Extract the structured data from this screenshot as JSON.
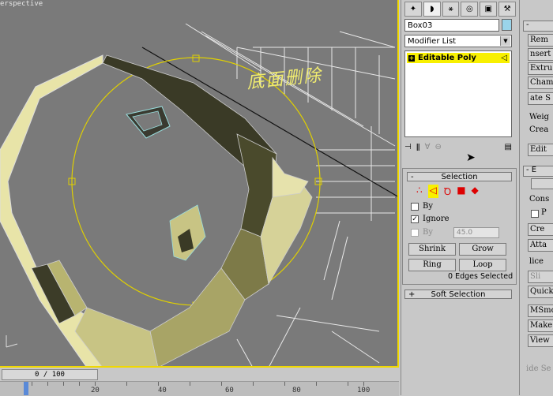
{
  "viewport": {
    "label": "erspective",
    "annotation": "底面删除"
  },
  "timeline": {
    "frame": "0 / 100",
    "ruler_ticks": [
      "20",
      "40",
      "60",
      "80",
      "100"
    ]
  },
  "panel": {
    "tabs": [
      "create-icon",
      "modify-icon",
      "hierarchy-icon",
      "motion-icon",
      "display-icon",
      "utilities-icon"
    ],
    "object_name": "Box03",
    "object_color": "#9ad4ea",
    "modifier_list": "Modifier List",
    "stack_item": "Editable Poly",
    "selection": {
      "title": "Selection",
      "by_vertex": "By",
      "ignore_backfacing": "Ignore",
      "by_angle": "By",
      "angle_value": "45.0",
      "shrink": "Shrink",
      "grow": "Grow",
      "ring": "Ring",
      "loop": "Loop",
      "status": "0 Edges Selected"
    },
    "soft_selection": "Soft Selection"
  },
  "panel2": {
    "buttons_top": [
      "Rem",
      "nsert",
      "Extru",
      "Chamf",
      "ate S"
    ],
    "weld_label": "Weig",
    "crease_label": "Crea",
    "edit_label": "Edit",
    "section_b": "E",
    "cons_label": "Cons",
    "p_label": "P",
    "create_btn": "Cre",
    "attach_btn": "Atta",
    "slice_label": "lice",
    "slice_btn": "Sli",
    "quick_btn": "Quick",
    "msmooth_btn": "MSmoo",
    "make_btn": "Make",
    "view_btn": "View",
    "hide_btn": "ide Se"
  },
  "colors": {
    "selection_highlight": "#f8f000",
    "viewport_bg": "#7a7a7a",
    "gizmo": "#e0d000"
  }
}
